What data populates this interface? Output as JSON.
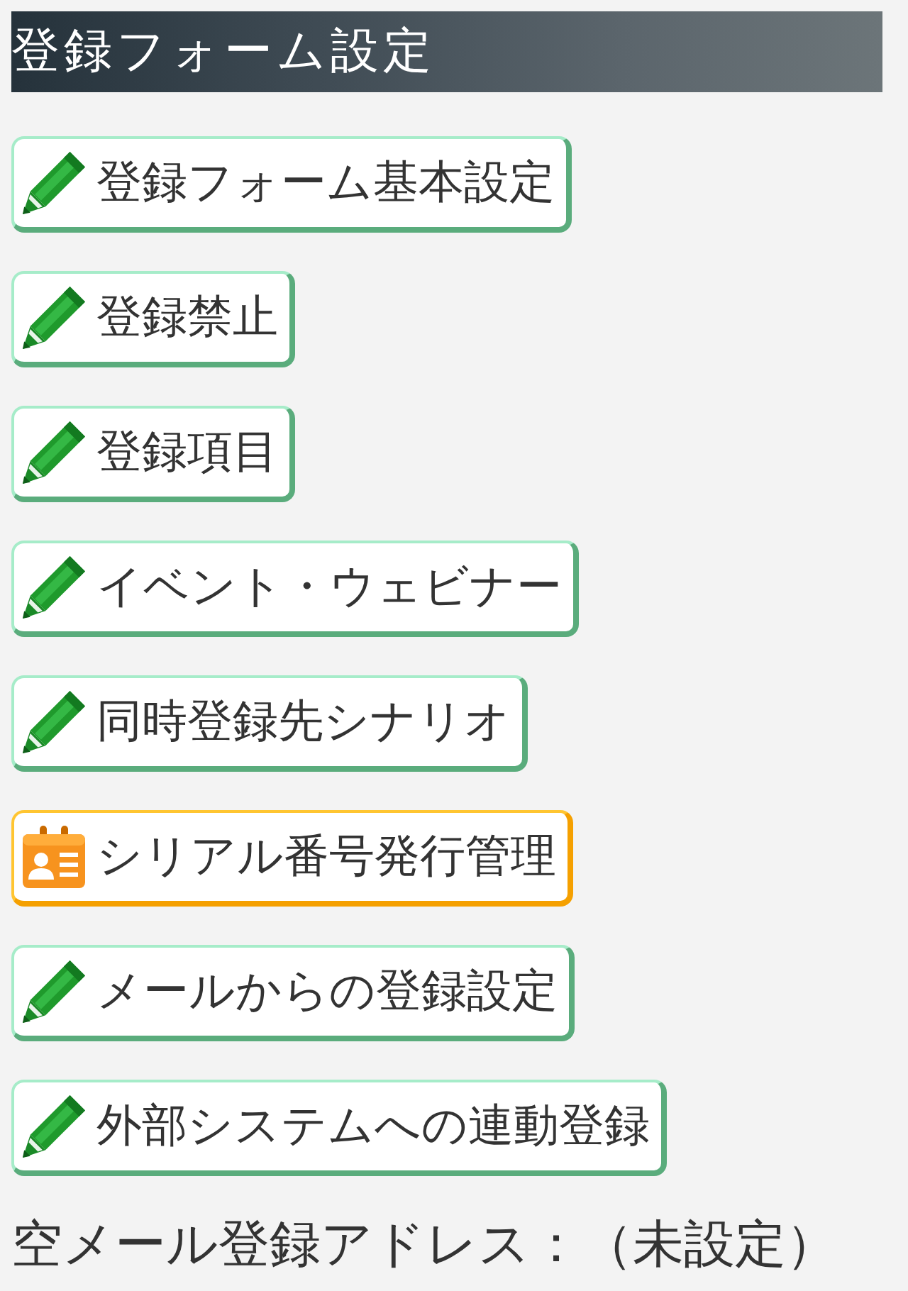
{
  "header": {
    "title": "登録フォーム設定"
  },
  "buttons": [
    {
      "label": "登録フォーム基本設定",
      "kind": "edit"
    },
    {
      "label": "登録禁止",
      "kind": "edit"
    },
    {
      "label": "登録項目",
      "kind": "edit"
    },
    {
      "label": "イベント・ウェビナー",
      "kind": "edit"
    },
    {
      "label": "同時登録先シナリオ",
      "kind": "edit"
    },
    {
      "label": "シリアル番号発行管理",
      "kind": "serial"
    },
    {
      "label": "メールからの登録設定",
      "kind": "edit"
    },
    {
      "label": "外部システムへの連動登録",
      "kind": "edit"
    }
  ],
  "empty_mail_address": {
    "text": "空メール登録アドレス：（未設定）"
  }
}
